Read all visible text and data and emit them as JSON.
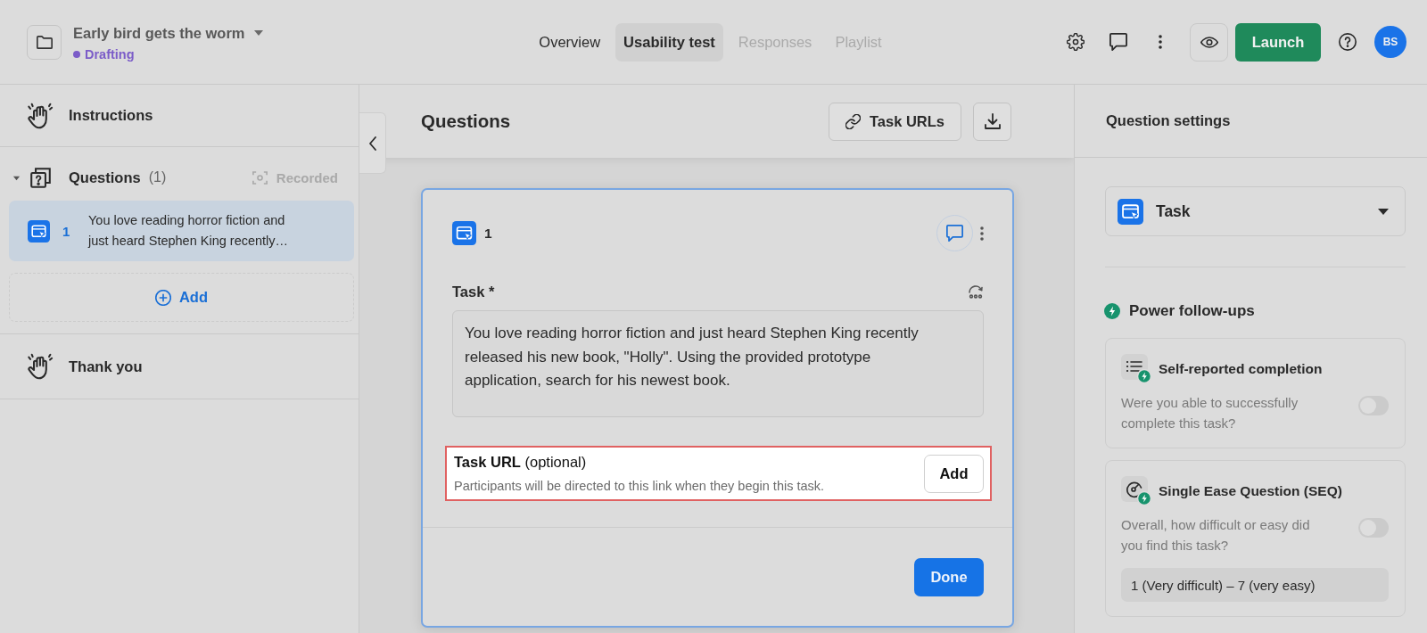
{
  "header": {
    "project_title": "Early bird gets the worm",
    "status": "Drafting",
    "tabs": [
      {
        "label": "Overview",
        "selected": false,
        "disabled": false
      },
      {
        "label": "Usability test",
        "selected": true,
        "disabled": false
      },
      {
        "label": "Responses",
        "selected": false,
        "disabled": true
      },
      {
        "label": "Playlist",
        "selected": false,
        "disabled": true
      }
    ],
    "launch_button": "Launch",
    "avatar_initials": "BS"
  },
  "sidebar": {
    "instructions": "Instructions",
    "questions": {
      "title": "Questions",
      "count": "(1)",
      "expanded": true,
      "recorded": "Recorded",
      "items": [
        {
          "number": "1",
          "text": "You love reading horror fiction and just heard Stephen King recently…",
          "selected": true
        }
      ],
      "add_button": "Add"
    },
    "thank_you": "Thank you"
  },
  "editor": {
    "title": "Questions",
    "task_urls_button": "Task URLs",
    "question": {
      "number": "1",
      "task_label": "Task *",
      "task_text": "You love reading horror fiction and just heard Stephen King recently released his new book, \"Holly\". Using the provided prototype application, search for his newest book.",
      "task_url": {
        "label": "**Task URL** (optional)",
        "hint": "Participants will be directed to this link when they begin this task.",
        "add_button": "Add",
        "highlighted": true
      },
      "done_button": "Done"
    }
  },
  "settings": {
    "title": "Question settings",
    "question_type": "Task",
    "followups": {
      "title": "Power follow-ups",
      "items": [
        {
          "kind": "checklist",
          "title": "Self-reported completion",
          "question": "Were you able to successfully complete this task?",
          "on": false
        },
        {
          "kind": "rating",
          "title": "Single Ease Question (SEQ)",
          "question": "Overall, how difficult or easy did you find this task?",
          "on": false,
          "scale": "1 (Very difficult) – 7 (very easy)"
        }
      ]
    }
  }
}
